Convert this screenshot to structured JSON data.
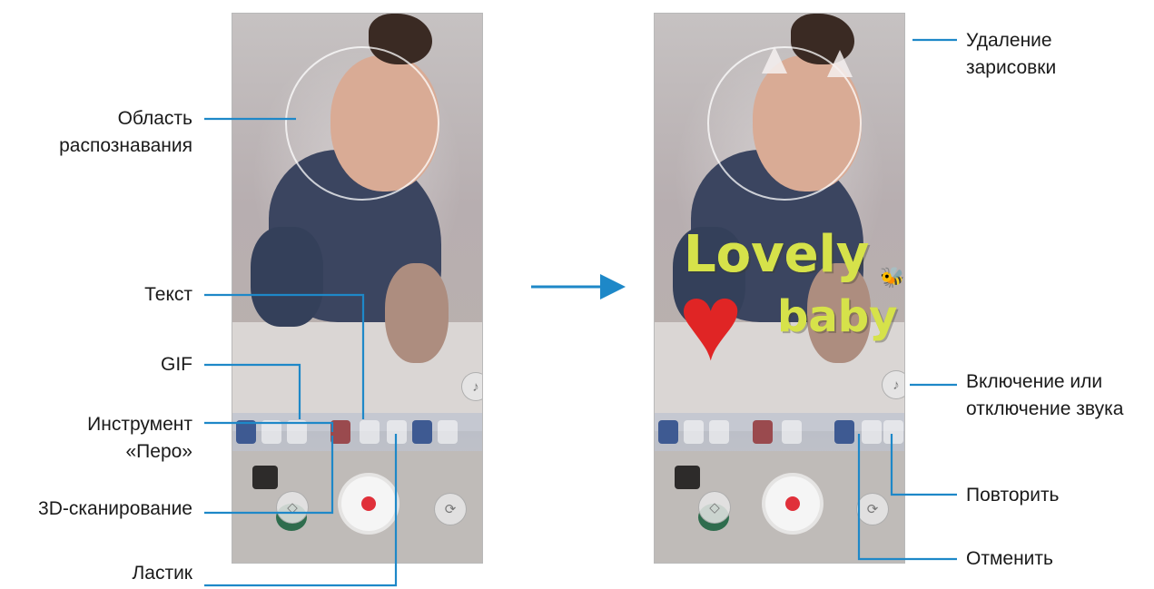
{
  "left_callouts": {
    "recognition_area": "Область\nраспознавания",
    "text": "Текст",
    "gif": "GIF",
    "pen_tool": "Инструмент\n«Перо»",
    "scan_3d": "3D-сканирование",
    "eraser": "Ластик"
  },
  "right_callouts": {
    "delete_drawing": "Удаление\nзарисовки",
    "sound_toggle": "Включение или\nотключение звука",
    "redo": "Повторить",
    "undo": "Отменить"
  },
  "stickers": {
    "word1": "Lovely",
    "word2": "baby"
  },
  "icons": {
    "sound_icon": "speaker-icon",
    "shutter_icon": "record-icon",
    "switch_icon": "camera-switch-icon"
  },
  "colors": {
    "callout_line": "#1e88c8",
    "arrow": "#1e88c8",
    "sticker_yellow": "#d6e24a",
    "heart": "#e02525"
  }
}
